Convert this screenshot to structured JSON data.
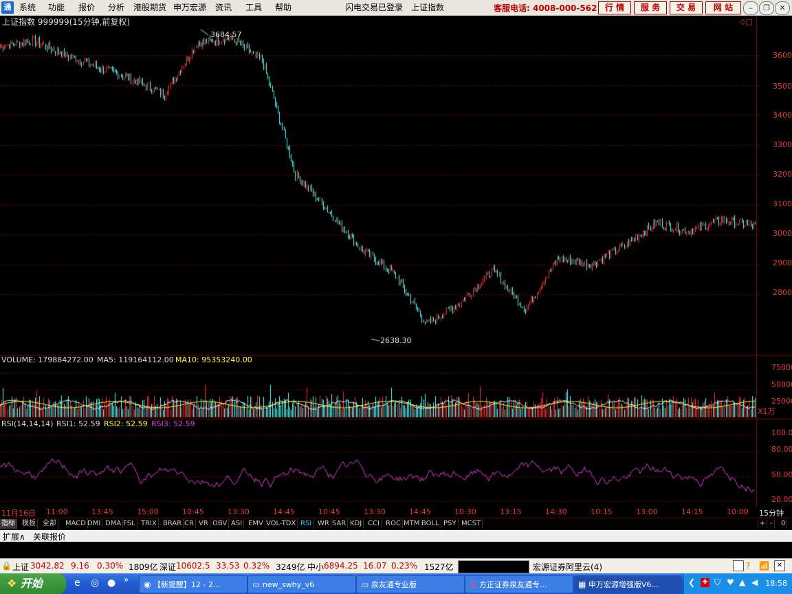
{
  "menu": {
    "items": [
      "系统",
      "功能",
      "报价",
      "分析",
      "港股期货",
      "申万宏源",
      "资讯",
      "工具",
      "帮助"
    ],
    "center_status": "闪电交易已登录",
    "index_name": "上证指数",
    "hotline": "客服电话: 4008-000-562",
    "buttons": [
      "行 情",
      "服 务",
      "交 易",
      "网 站"
    ]
  },
  "chart_header": {
    "title": "上证指数 999999(15分钟,前复权)",
    "high_label": "3684.57",
    "low_label": "2638.30"
  },
  "price_axis": {
    "ticks": [
      "3600",
      "3500",
      "3400",
      "3300",
      "3200",
      "3100",
      "3000",
      "2900",
      "2800"
    ]
  },
  "volume_panel": {
    "label_volume": "VOLUME: 179884272.00",
    "label_ma5": "MA5: 119164112.00",
    "label_ma10": "MA10: 95353240.00",
    "ticks": [
      "75000",
      "50000",
      "25000"
    ],
    "unit": "X1万"
  },
  "rsi_panel": {
    "label_rsi": "RSI(14,14,14)",
    "label_rsi1": "RSI1: 52.59",
    "label_rsi2": "RSI2: 52.59",
    "label_rsi3": "RSI3: 52.59",
    "ticks": [
      "100.00",
      "80.00",
      "50.00",
      "20.00"
    ]
  },
  "time_axis": {
    "labels": [
      "11月16日",
      "11:00",
      "13:45",
      "15:00",
      "10:45",
      "13:30",
      "14:45",
      "10:45",
      "13:30",
      "14:45",
      "10:30",
      "13:15",
      "14:30",
      "10:15",
      "13:00",
      "14:15",
      "10:00"
    ],
    "unit": "15分钟"
  },
  "indicator_tabs": [
    "指标",
    "模板",
    "全部",
    "MACD",
    "DMI",
    "DMA",
    "FSL",
    "TRIX",
    "BRAR",
    "CR",
    "VR",
    "OBV",
    "ASI",
    "EMV",
    "VOL-TDX",
    "RSI",
    "WR",
    "SAR",
    "KDJ",
    "CCI",
    "ROC",
    "MTM",
    "BOLL",
    "PSY",
    "MCST"
  ],
  "indicator_controls": [
    "+",
    "-",
    "0"
  ],
  "ext_row": [
    "扩展∧",
    "关联报价"
  ],
  "status_bar": {
    "sh_label": "上证",
    "sh_value": "3042.82",
    "sh_change": "9.16",
    "sh_pct": "0.30%",
    "sh_amount": "1809亿",
    "sz_label": "深证",
    "sz_value": "10602.5",
    "sz_change": "33.53",
    "sz_pct": "0.32%",
    "sz_amount": "3249亿",
    "zx_label": "中小",
    "zx_value": "6894.25",
    "zx_change": "16.07",
    "zx_pct": "0.23%",
    "zx_amount": "1527亿",
    "server": "宏源证券阿里云(4)"
  },
  "taskbar": {
    "start": "开始",
    "tasks": [
      "【新提醒】12 - 2...",
      "new_swhy_v6",
      "泉友通专业版",
      "方正证券泉友通专...",
      "申万宏源增强版V6..."
    ],
    "clock": "18:58"
  },
  "colors": {
    "up": "#ff3232",
    "down": "#54ffff",
    "ma10": "#ffff40",
    "rsi": "#e040e0",
    "grid": "#8b0000"
  },
  "chart_data": {
    "type": "line",
    "x": [
      "11月16日",
      "11:00",
      "13:45",
      "15:00",
      "10:45",
      "13:30",
      "14:45",
      "10:45",
      "13:30",
      "14:45",
      "10:30",
      "13:15",
      "14:30",
      "10:15",
      "13:00",
      "14:15",
      "10:00"
    ],
    "series": [
      {
        "values": [
          3630,
          3650,
          3600,
          3560,
          3520,
          3470,
          3640,
          3660,
          3580,
          3200,
          3080,
          2950,
          2870,
          2700,
          2770,
          2880,
          2750,
          2920,
          2900,
          2960,
          3040,
          3010,
          3050,
          3030
        ]
      }
    ],
    "ylim": [
      2600,
      3700
    ]
  }
}
